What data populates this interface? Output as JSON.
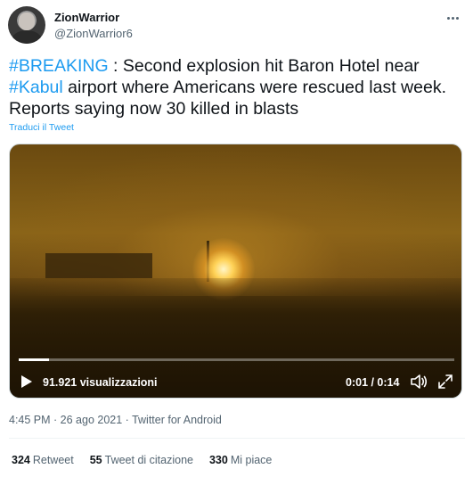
{
  "author": {
    "name": "ZionWarrior",
    "handle": "@ZionWarrior6"
  },
  "tweet": {
    "hashtag_breaking": "#BREAKING",
    "text_part1": " : Second explosion hit Baron Hotel near ",
    "hashtag_kabul": "#Kabul",
    "text_part2": " airport where Americans were rescued last week. Reports saying now 30 killed in blasts",
    "translate_label": "Traduci il Tweet"
  },
  "video": {
    "views": "91.921 visualizzazioni",
    "time": "0:01 / 0:14",
    "progress": 0.07
  },
  "meta": {
    "time": "4:45 PM",
    "separator1": " · ",
    "date": "26 ago 2021",
    "separator2": " · ",
    "source": "Twitter for Android"
  },
  "stats": {
    "retweets_count": "324",
    "retweets_label": "Retweet",
    "quotes_count": "55",
    "quotes_label": "Tweet di citazione",
    "likes_count": "330",
    "likes_label": "Mi piace"
  },
  "colors": {
    "link": "#1d9bf0",
    "text": "#0f1419",
    "secondary": "#536471"
  }
}
